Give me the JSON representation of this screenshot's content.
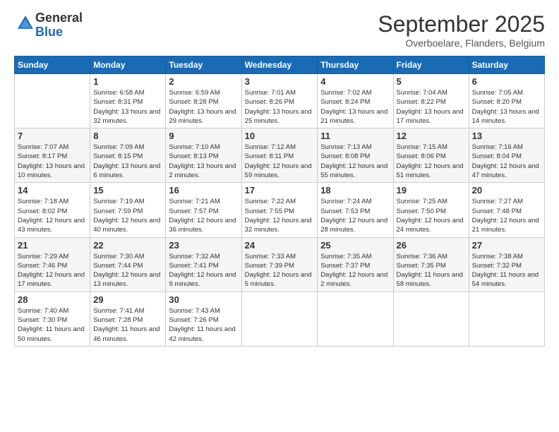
{
  "header": {
    "logo_general": "General",
    "logo_blue": "Blue",
    "month_title": "September 2025",
    "location": "Overboelare, Flanders, Belgium"
  },
  "days_of_week": [
    "Sunday",
    "Monday",
    "Tuesday",
    "Wednesday",
    "Thursday",
    "Friday",
    "Saturday"
  ],
  "weeks": [
    [
      {
        "num": "",
        "sunrise": "",
        "sunset": "",
        "daylight": ""
      },
      {
        "num": "1",
        "sunrise": "Sunrise: 6:58 AM",
        "sunset": "Sunset: 8:31 PM",
        "daylight": "Daylight: 13 hours and 32 minutes."
      },
      {
        "num": "2",
        "sunrise": "Sunrise: 6:59 AM",
        "sunset": "Sunset: 8:28 PM",
        "daylight": "Daylight: 13 hours and 29 minutes."
      },
      {
        "num": "3",
        "sunrise": "Sunrise: 7:01 AM",
        "sunset": "Sunset: 8:26 PM",
        "daylight": "Daylight: 13 hours and 25 minutes."
      },
      {
        "num": "4",
        "sunrise": "Sunrise: 7:02 AM",
        "sunset": "Sunset: 8:24 PM",
        "daylight": "Daylight: 13 hours and 21 minutes."
      },
      {
        "num": "5",
        "sunrise": "Sunrise: 7:04 AM",
        "sunset": "Sunset: 8:22 PM",
        "daylight": "Daylight: 13 hours and 17 minutes."
      },
      {
        "num": "6",
        "sunrise": "Sunrise: 7:05 AM",
        "sunset": "Sunset: 8:20 PM",
        "daylight": "Daylight: 13 hours and 14 minutes."
      }
    ],
    [
      {
        "num": "7",
        "sunrise": "Sunrise: 7:07 AM",
        "sunset": "Sunset: 8:17 PM",
        "daylight": "Daylight: 13 hours and 10 minutes."
      },
      {
        "num": "8",
        "sunrise": "Sunrise: 7:09 AM",
        "sunset": "Sunset: 8:15 PM",
        "daylight": "Daylight: 13 hours and 6 minutes."
      },
      {
        "num": "9",
        "sunrise": "Sunrise: 7:10 AM",
        "sunset": "Sunset: 8:13 PM",
        "daylight": "Daylight: 13 hours and 2 minutes."
      },
      {
        "num": "10",
        "sunrise": "Sunrise: 7:12 AM",
        "sunset": "Sunset: 8:11 PM",
        "daylight": "Daylight: 12 hours and 59 minutes."
      },
      {
        "num": "11",
        "sunrise": "Sunrise: 7:13 AM",
        "sunset": "Sunset: 8:08 PM",
        "daylight": "Daylight: 12 hours and 55 minutes."
      },
      {
        "num": "12",
        "sunrise": "Sunrise: 7:15 AM",
        "sunset": "Sunset: 8:06 PM",
        "daylight": "Daylight: 12 hours and 51 minutes."
      },
      {
        "num": "13",
        "sunrise": "Sunrise: 7:16 AM",
        "sunset": "Sunset: 8:04 PM",
        "daylight": "Daylight: 12 hours and 47 minutes."
      }
    ],
    [
      {
        "num": "14",
        "sunrise": "Sunrise: 7:18 AM",
        "sunset": "Sunset: 8:02 PM",
        "daylight": "Daylight: 12 hours and 43 minutes."
      },
      {
        "num": "15",
        "sunrise": "Sunrise: 7:19 AM",
        "sunset": "Sunset: 7:59 PM",
        "daylight": "Daylight: 12 hours and 40 minutes."
      },
      {
        "num": "16",
        "sunrise": "Sunrise: 7:21 AM",
        "sunset": "Sunset: 7:57 PM",
        "daylight": "Daylight: 12 hours and 36 minutes."
      },
      {
        "num": "17",
        "sunrise": "Sunrise: 7:22 AM",
        "sunset": "Sunset: 7:55 PM",
        "daylight": "Daylight: 12 hours and 32 minutes."
      },
      {
        "num": "18",
        "sunrise": "Sunrise: 7:24 AM",
        "sunset": "Sunset: 7:53 PM",
        "daylight": "Daylight: 12 hours and 28 minutes."
      },
      {
        "num": "19",
        "sunrise": "Sunrise: 7:25 AM",
        "sunset": "Sunset: 7:50 PM",
        "daylight": "Daylight: 12 hours and 24 minutes."
      },
      {
        "num": "20",
        "sunrise": "Sunrise: 7:27 AM",
        "sunset": "Sunset: 7:48 PM",
        "daylight": "Daylight: 12 hours and 21 minutes."
      }
    ],
    [
      {
        "num": "21",
        "sunrise": "Sunrise: 7:29 AM",
        "sunset": "Sunset: 7:46 PM",
        "daylight": "Daylight: 12 hours and 17 minutes."
      },
      {
        "num": "22",
        "sunrise": "Sunrise: 7:30 AM",
        "sunset": "Sunset: 7:44 PM",
        "daylight": "Daylight: 12 hours and 13 minutes."
      },
      {
        "num": "23",
        "sunrise": "Sunrise: 7:32 AM",
        "sunset": "Sunset: 7:41 PM",
        "daylight": "Daylight: 12 hours and 9 minutes."
      },
      {
        "num": "24",
        "sunrise": "Sunrise: 7:33 AM",
        "sunset": "Sunset: 7:39 PM",
        "daylight": "Daylight: 12 hours and 5 minutes."
      },
      {
        "num": "25",
        "sunrise": "Sunrise: 7:35 AM",
        "sunset": "Sunset: 7:37 PM",
        "daylight": "Daylight: 12 hours and 2 minutes."
      },
      {
        "num": "26",
        "sunrise": "Sunrise: 7:36 AM",
        "sunset": "Sunset: 7:35 PM",
        "daylight": "Daylight: 11 hours and 58 minutes."
      },
      {
        "num": "27",
        "sunrise": "Sunrise: 7:38 AM",
        "sunset": "Sunset: 7:32 PM",
        "daylight": "Daylight: 11 hours and 54 minutes."
      }
    ],
    [
      {
        "num": "28",
        "sunrise": "Sunrise: 7:40 AM",
        "sunset": "Sunset: 7:30 PM",
        "daylight": "Daylight: 11 hours and 50 minutes."
      },
      {
        "num": "29",
        "sunrise": "Sunrise: 7:41 AM",
        "sunset": "Sunset: 7:28 PM",
        "daylight": "Daylight: 11 hours and 46 minutes."
      },
      {
        "num": "30",
        "sunrise": "Sunrise: 7:43 AM",
        "sunset": "Sunset: 7:26 PM",
        "daylight": "Daylight: 11 hours and 42 minutes."
      },
      {
        "num": "",
        "sunrise": "",
        "sunset": "",
        "daylight": ""
      },
      {
        "num": "",
        "sunrise": "",
        "sunset": "",
        "daylight": ""
      },
      {
        "num": "",
        "sunrise": "",
        "sunset": "",
        "daylight": ""
      },
      {
        "num": "",
        "sunrise": "",
        "sunset": "",
        "daylight": ""
      }
    ]
  ]
}
